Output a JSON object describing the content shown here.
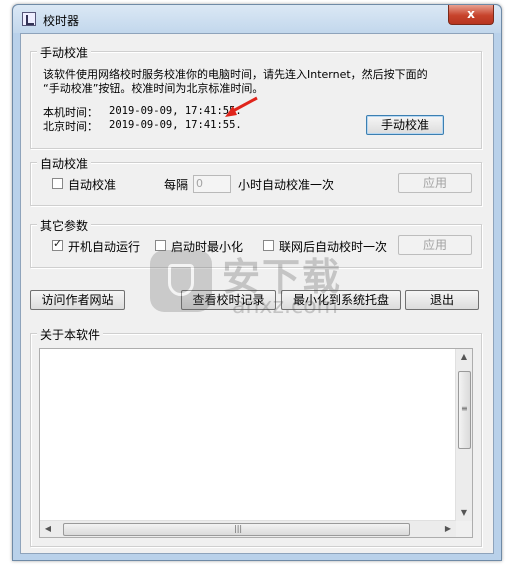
{
  "window": {
    "title": "校时器",
    "close_label": "x"
  },
  "manual": {
    "legend": "手动校准",
    "desc_line1": "该软件使用网络校时服务校准你的电脑时间，请先连入Internet，然后按下面的",
    "desc_line2": "“手动校准”按钮。校准时间为北京标准时间。",
    "local_label": "本机时间：",
    "local_time": "2019-09-09, 17:41:55.",
    "beijing_label": "北京时间：",
    "beijing_time": "2019-09-09, 17:41:55.",
    "button": "手动校准"
  },
  "auto": {
    "legend": "自动校准",
    "checkbox_label": "自动校准",
    "checked": false,
    "every_label": "每隔",
    "interval_value": "0",
    "suffix_label": "小时自动校准一次",
    "apply": "应用"
  },
  "other": {
    "legend": "其它参数",
    "startup_label": "开机自动运行",
    "startup_checked": true,
    "minimize_label": "启动时最小化",
    "minimize_checked": false,
    "network_label": "联网后自动校时一次",
    "network_checked": false,
    "apply": "应用"
  },
  "actions": {
    "visit_site": "访问作者网站",
    "view_log": "查看校时记录",
    "minimize_tray": "最小化到系统托盘",
    "exit": "退出"
  },
  "about": {
    "legend": "关于本软件",
    "content": ""
  },
  "watermark": {
    "text": "安下载",
    "subtext": "anxz.com"
  },
  "colors": {
    "annotation_arrow": "#e0241b",
    "close_button": "#c7432c"
  }
}
